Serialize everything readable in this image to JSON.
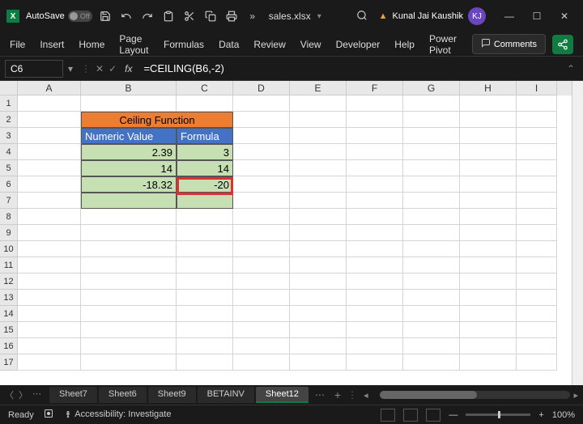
{
  "titlebar": {
    "autosave_label": "AutoSave",
    "autosave_state": "Off",
    "filename": "sales.xlsx",
    "user_name": "Kunal Jai Kaushik",
    "user_initials": "KJ"
  },
  "ribbon": {
    "tabs": [
      "File",
      "Insert",
      "Home",
      "Page Layout",
      "Formulas",
      "Data",
      "Review",
      "View",
      "Developer",
      "Help",
      "Power Pivot"
    ],
    "comments_label": "Comments"
  },
  "formula_bar": {
    "name_box": "C6",
    "formula": "=CEILING(B6,-2)"
  },
  "columns": [
    "A",
    "B",
    "C",
    "D",
    "E",
    "F",
    "G",
    "H",
    "I"
  ],
  "row_numbers": [
    "1",
    "2",
    "3",
    "4",
    "5",
    "6",
    "7",
    "8",
    "9",
    "10",
    "11",
    "12",
    "13",
    "14",
    "15",
    "16",
    "17"
  ],
  "table": {
    "title": "Ceiling Function",
    "headers": {
      "b": "Numeric Value",
      "c": "Formula"
    },
    "rows": [
      {
        "b": "2.39",
        "c": "3"
      },
      {
        "b": "14",
        "c": "14"
      },
      {
        "b": "-18.32",
        "c": "-20"
      },
      {
        "b": "",
        "c": ""
      }
    ]
  },
  "sheets": {
    "tabs": [
      "Sheet7",
      "Sheet6",
      "Sheet9",
      "BETAINV",
      "Sheet12"
    ],
    "active": "Sheet12"
  },
  "status": {
    "ready": "Ready",
    "accessibility": "Accessibility: Investigate",
    "zoom": "100%"
  },
  "chart_data": {
    "type": "table",
    "title": "Ceiling Function",
    "columns": [
      "Numeric Value",
      "Formula"
    ],
    "rows": [
      [
        2.39,
        3
      ],
      [
        14,
        14
      ],
      [
        -18.32,
        -20
      ]
    ]
  }
}
